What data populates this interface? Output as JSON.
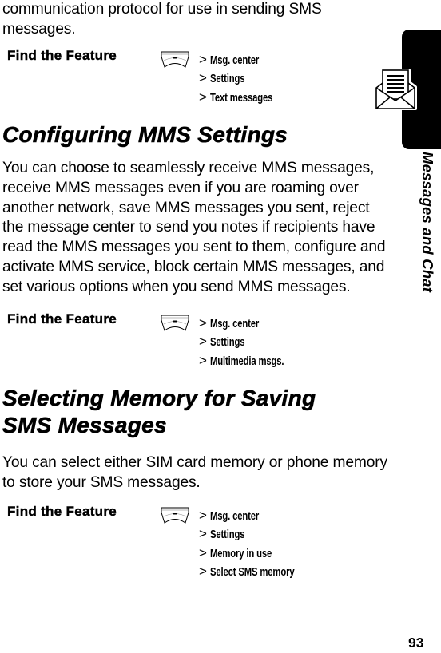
{
  "intro": {
    "text": "communication protocol for use in sending SMS messages."
  },
  "find_feature_label": "Find the Feature",
  "menu_key_icon": "menu-key-icon",
  "find_feature_1": {
    "path": [
      {
        "sep": ">",
        "label": "Msg. center"
      },
      {
        "sep": ">",
        "label": "Settings"
      },
      {
        "sep": ">",
        "label": "Text messages"
      }
    ]
  },
  "section_mms": {
    "heading": "Configuring MMS Settings",
    "body": "You can choose to seamlessly receive MMS messages, receive MMS messages even if you are roaming over another network, save MMS messages you sent, reject the message center to send you notes if recipients have read the MMS messages you sent to them, configure and activate MMS service, block certain MMS messages, and set various options when you send MMS messages."
  },
  "find_feature_2": {
    "path": [
      {
        "sep": ">",
        "label": "Msg. center"
      },
      {
        "sep": ">",
        "label": "Settings"
      },
      {
        "sep": ">",
        "label": "Multimedia msgs."
      }
    ]
  },
  "section_memory": {
    "heading_line1": "Selecting Memory for Saving",
    "heading_line2": "SMS Messages",
    "body": "You can select either SIM card memory or phone memory to store your SMS messages."
  },
  "find_feature_3": {
    "path": [
      {
        "sep": ">",
        "label": "Msg. center"
      },
      {
        "sep": ">",
        "label": "Settings"
      },
      {
        "sep": ">",
        "label": "Memory in use"
      },
      {
        "sep": ">",
        "label": "Select SMS memory"
      }
    ]
  },
  "sidebar": {
    "section_title": "Messages and Chat",
    "icon": "envelope-letter-icon"
  },
  "footer": {
    "page_number": "93"
  }
}
